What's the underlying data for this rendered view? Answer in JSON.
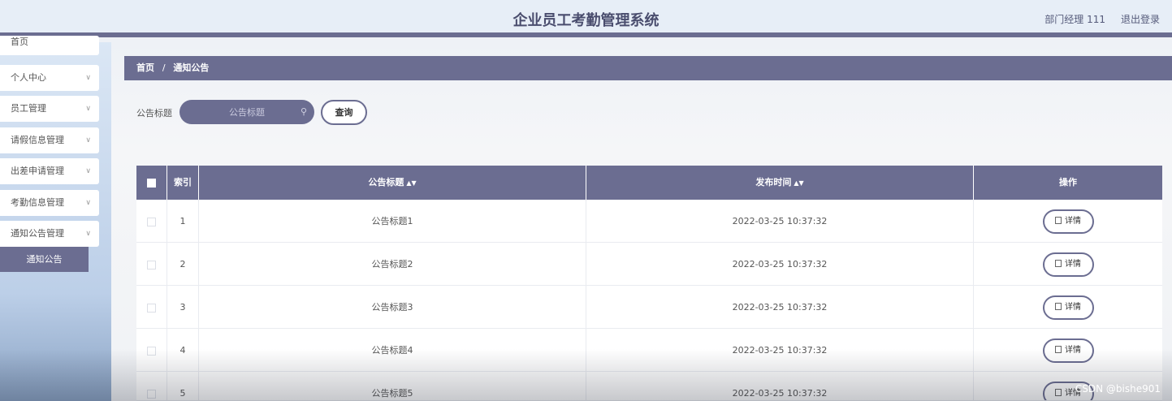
{
  "header": {
    "title": "企业员工考勤管理系统",
    "user": "部门经理 111",
    "logout": "退出登录"
  },
  "sidebar": {
    "items": [
      {
        "label": "首页"
      },
      {
        "label": "个人中心"
      },
      {
        "label": "员工管理"
      },
      {
        "label": "请假信息管理"
      },
      {
        "label": "出差申请管理"
      },
      {
        "label": "考勤信息管理"
      },
      {
        "label": "通知公告管理"
      }
    ],
    "sub_item": "通知公告"
  },
  "breadcrumb": {
    "home": "首页",
    "separator": "/",
    "current": "通知公告"
  },
  "search": {
    "label": "公告标题",
    "placeholder": "公告标题",
    "button": "查询"
  },
  "table": {
    "headers": {
      "index": "索引",
      "title": "公告标题",
      "time": "发布时间",
      "action": "操作"
    },
    "rows": [
      {
        "index": "1",
        "title": "公告标题1",
        "time": "2022-03-25 10:37:32",
        "action": "详情"
      },
      {
        "index": "2",
        "title": "公告标题2",
        "time": "2022-03-25 10:37:32",
        "action": "详情"
      },
      {
        "index": "3",
        "title": "公告标题3",
        "time": "2022-03-25 10:37:32",
        "action": "详情"
      },
      {
        "index": "4",
        "title": "公告标题4",
        "time": "2022-03-25 10:37:32",
        "action": "详情"
      },
      {
        "index": "5",
        "title": "公告标题5",
        "time": "2022-03-25 10:37:32",
        "action": "详情"
      }
    ]
  },
  "watermark": "CSDN @bishe901",
  "colors": {
    "accent": "#6b6d91",
    "header_bg": "#e7eef7"
  }
}
